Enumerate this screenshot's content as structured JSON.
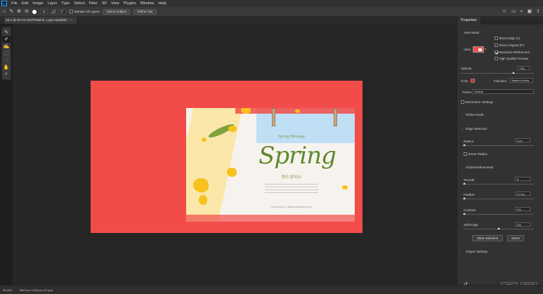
{
  "app": {
    "logo": "Ps"
  },
  "menu": [
    "File",
    "Edit",
    "Image",
    "Layer",
    "Type",
    "Select",
    "Filter",
    "3D",
    "View",
    "Plugins",
    "Window",
    "Help"
  ],
  "options": {
    "brush_size": "10",
    "angle": "0°",
    "sample_all_layers": "Sample All Layers",
    "select_subject": "Select Subject",
    "refine_hair": "Refine Hair"
  },
  "document": {
    "tab_title": "nd-1 @ 50.1% (h37f7a6572, Layer Mask/8) *",
    "close": "×"
  },
  "artwork": {
    "tagline": "Spring Message",
    "title": "Spring",
    "korean": "봄이 왔어요!",
    "copyright": "COPYRIGHT (C) TEMPLATE MARKET INC"
  },
  "panel": {
    "tab": "Properties",
    "view_mode": "View Mode",
    "view": "View:",
    "show_edge": "Show Edge (J)",
    "show_original": "Show Original (P)",
    "real_time": "Real-time Refinement",
    "high_quality": "High Quality Preview",
    "opacity_label": "Opacity",
    "opacity_value": "73%",
    "color_label": "Color",
    "indicates_label": "Indicates:",
    "indicates_value": "Masked Areas",
    "preset_label": "Preset",
    "preset_value": "Default",
    "remember": "Remember Settings",
    "refine_modes": "Refine Mode",
    "edge_detection": "Edge Detection",
    "radius_label": "Radius",
    "radius_value": "0 px",
    "smart_radius": "Smart Radius",
    "global_refinements": "Global Refinements",
    "smooth_label": "Smooth",
    "smooth_value": "0",
    "feather_label": "Feather",
    "feather_value": "0.0 px",
    "contrast_label": "Contrast",
    "contrast_value": "0%",
    "shift_edge_label": "Shift Edge",
    "shift_edge_value": "0%",
    "clear_selection": "Clear Selection",
    "invert": "Invert",
    "output_settings": "Output Settings",
    "ok": "OK",
    "cancel": "Cancel"
  },
  "status": {
    "zoom": "50.09%",
    "doc_size": "3543 px x 2303 px (72 ppi)"
  }
}
